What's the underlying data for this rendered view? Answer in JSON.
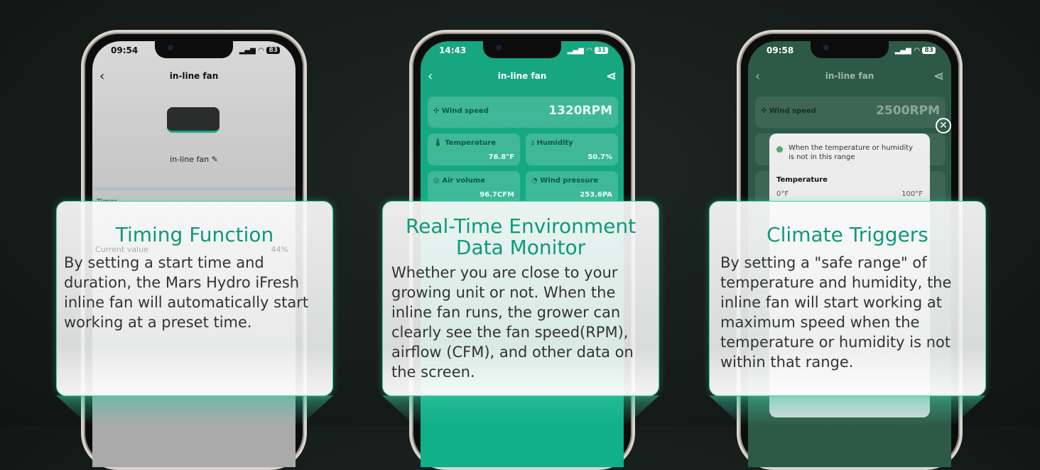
{
  "phones": [
    {
      "time": "09:54",
      "battery": "83",
      "title": "in-line fan",
      "device_name": "in-line fan",
      "timer_label": "Timer",
      "ghost_label": "Current value",
      "ghost_value": "44%"
    },
    {
      "time": "14:43",
      "battery": "31",
      "title": "in-line fan",
      "wind_speed": {
        "label": "Wind speed",
        "value": "1320RPM"
      },
      "temperature": {
        "label": "Temperature",
        "value": "76.8°F"
      },
      "humidity": {
        "label": "Humidity",
        "value": "50.7%"
      },
      "air_volume": {
        "label": "Air volume",
        "value": "96.7CFM"
      },
      "wind_pressure": {
        "label": "Wind pressure",
        "value": "253.6PA"
      }
    },
    {
      "time": "09:58",
      "battery": "83",
      "title": "in-line fan",
      "wind_speed": {
        "label": "Wind speed",
        "value": "2500RPM"
      },
      "modal": {
        "message": "When the temperature or humidity is not in this range",
        "section": "Temperature",
        "min": "0°F",
        "max": "100°F"
      }
    }
  ],
  "panels": [
    {
      "title": "Timing Function",
      "body": "By setting a start time and duration, the Mars Hydro iFresh inline fan will automatically start working at a preset time."
    },
    {
      "title": "Real-Time Environment Data Monitor",
      "body": "Whether you are close to your growing unit or not. When the inline fan runs, the grower can clearly see the fan speed(RPM), airflow (CFM), and other data on the screen."
    },
    {
      "title": "Climate Triggers",
      "body": "By setting a \"safe range\" of temperature and humidity, the inline fan will start working at maximum speed when the temperature or humidity is not within that range."
    }
  ],
  "colors": {
    "accent": "#0e9a78",
    "app_green": "#17a67f"
  }
}
